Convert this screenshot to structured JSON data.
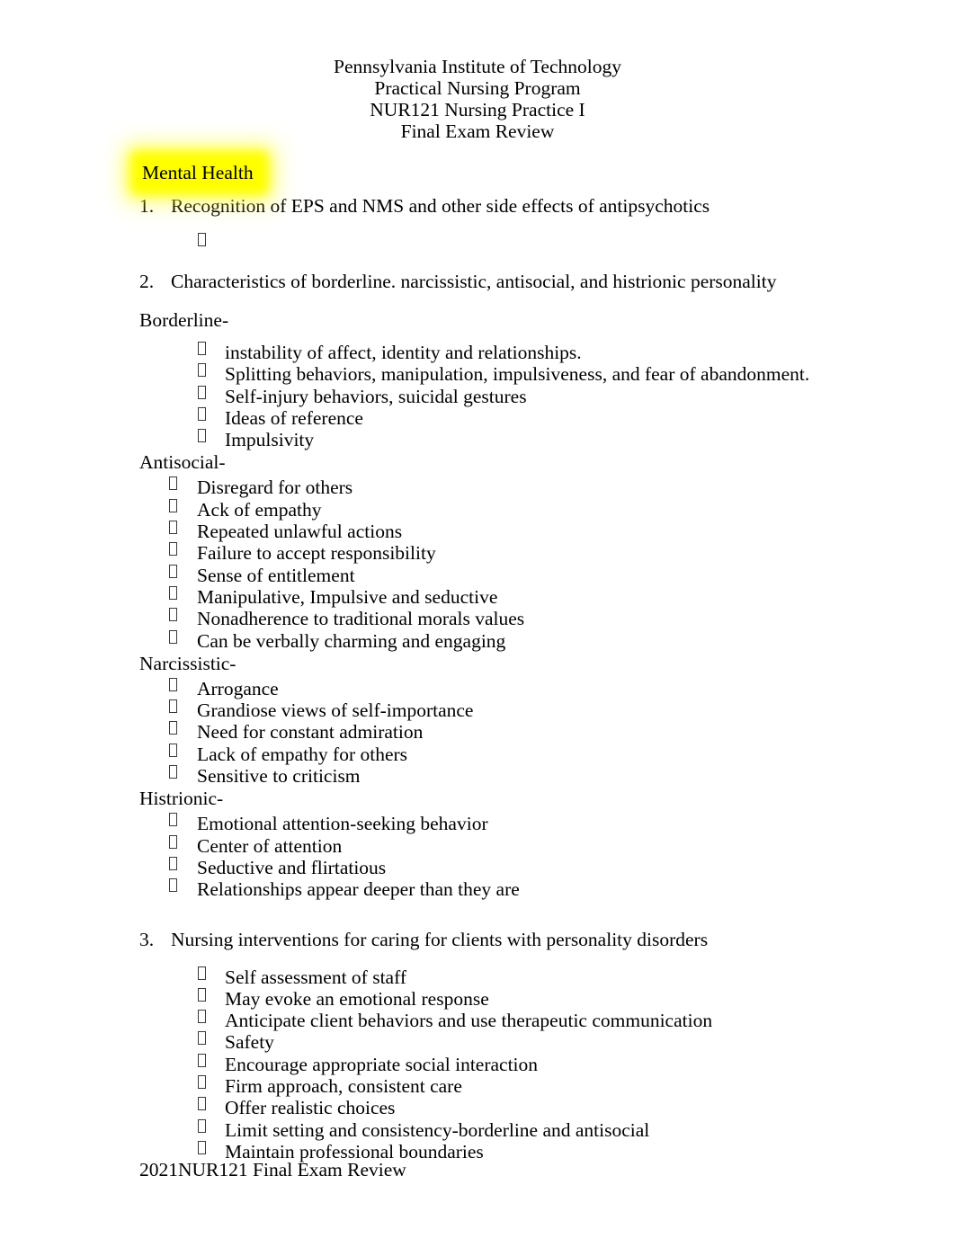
{
  "header": {
    "lines": [
      "Pennsylvania Institute of Technology",
      "Practical Nursing Program",
      "NUR121 Nursing Practice I",
      "Final Exam Review"
    ]
  },
  "section": {
    "title": "Mental Health",
    "highlight_color": "#FFFF00"
  },
  "items": [
    {
      "number": "1.",
      "text": "Recognition of EPS and NMS and other side effects of antipsychotics"
    },
    {
      "number": "2.",
      "text": "Characteristics of borderline. narcissistic, antisocial, and histrionic personality"
    },
    {
      "number": "3.",
      "text": "Nursing interventions for caring for clients with personality disorders"
    }
  ],
  "groups": {
    "borderline": {
      "heading": "Borderline-",
      "bullets": [
        "instability of affect, identity and relationships.",
        "Splitting behaviors, manipulation, impulsiveness, and fear of abandonment.",
        "Self-injury behaviors, suicidal gestures",
        "Ideas of reference",
        "Impulsivity"
      ]
    },
    "antisocial": {
      "heading": "Antisocial-",
      "bullets": [
        "Disregard for others",
        "Ack of empathy",
        "Repeated unlawful actions",
        "Failure to accept responsibility",
        "Sense of entitlement",
        "Manipulative, Impulsive and seductive",
        "Nonadherence to traditional morals values",
        "Can be verbally charming and engaging"
      ]
    },
    "narcissistic": {
      "heading": "Narcissistic-",
      "bullets": [
        "Arrogance",
        "Grandiose views of self-importance",
        "Need for constant admiration",
        "Lack of empathy for others",
        "Sensitive to criticism"
      ]
    },
    "histrionic": {
      "heading": "Histrionic-",
      "bullets": [
        "Emotional attention-seeking behavior",
        "Center of attention",
        "Seductive and flirtatious",
        "Relationships appear deeper than they are"
      ]
    },
    "interventions": {
      "bullets": [
        "Self assessment of staff",
        "May evoke an emotional response",
        "Anticipate client behaviors and use therapeutic communication",
        "Safety",
        "Encourage appropriate social interaction",
        "Firm approach, consistent care",
        "Offer realistic choices",
        "Limit setting and consistency-borderline and antisocial",
        "Maintain professional boundaries"
      ]
    }
  },
  "footer": {
    "text": "2021NUR121 Final Exam Review"
  }
}
